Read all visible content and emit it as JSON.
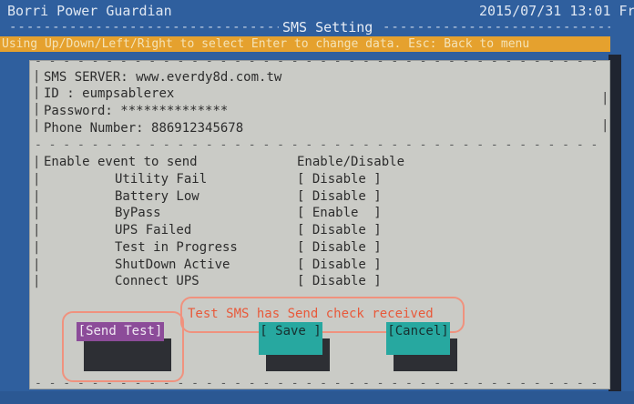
{
  "header": {
    "app_title": "Borri Power Guardian",
    "datetime": "2015/07/31 13:01 Fr",
    "screen_title": "SMS Setting"
  },
  "help_bar": "Using Up/Down/Left/Right to select Enter to change data. Esc: Back to menu",
  "sms_config": {
    "server_label": "SMS SERVER:",
    "server_value": "www.everdy8d.com.tw",
    "id_label": "ID :",
    "id_value": "eumpsablerex",
    "password_label": "Password:",
    "password_value": "**************",
    "phone_label": "Phone Number:",
    "phone_value": "886912345678"
  },
  "events": {
    "header_left": "Enable event to send",
    "header_right": "Enable/Disable",
    "items": [
      {
        "name": "Utility Fail",
        "state": "[ Disable ]"
      },
      {
        "name": "Battery Low",
        "state": "[ Disable ]"
      },
      {
        "name": "ByPass",
        "state": "[ Enable  ]"
      },
      {
        "name": "UPS Failed",
        "state": "[ Disable ]"
      },
      {
        "name": "Test in Progress",
        "state": "[ Disable ]"
      },
      {
        "name": "ShutDown Active",
        "state": "[ Disable ]"
      },
      {
        "name": "Connect UPS",
        "state": "[ Disable ]"
      }
    ]
  },
  "status_message": "Test SMS has Send check received",
  "buttons": {
    "send_test": "[Send Test]",
    "save": "[ Save ]",
    "cancel": "[Cancel]"
  },
  "colors": {
    "background": "#2f5f9e",
    "help_bar": "#e5a12e",
    "panel": "#cacbc6",
    "send_button": "#8c4c99",
    "action_button": "#27a8a0",
    "message": "#e8593a",
    "callout": "#f0927e"
  }
}
